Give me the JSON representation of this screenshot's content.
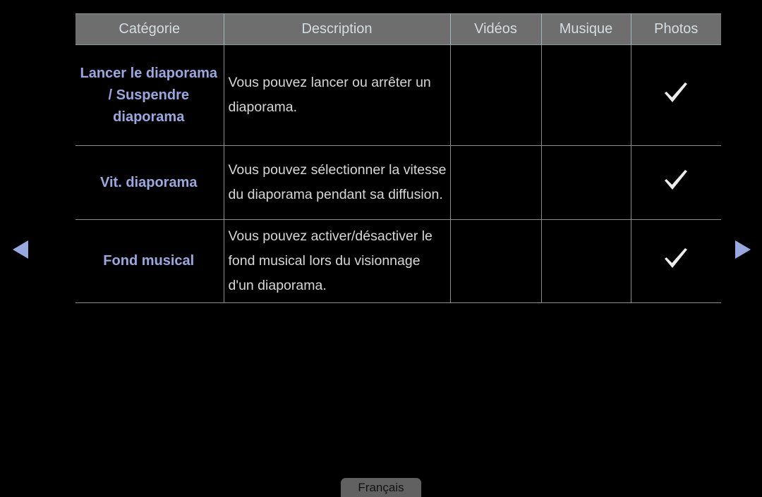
{
  "screen": {
    "background_color": "#000000",
    "accent_color": "#9aa8e0",
    "header_bg_color": "#6e6e6e",
    "description_text_color": "#d7d7d7"
  },
  "table": {
    "columns": [
      {
        "key": "categorie",
        "label": "Catégorie"
      },
      {
        "key": "description",
        "label": "Description"
      },
      {
        "key": "videos",
        "label": "Vidéos"
      },
      {
        "key": "musique",
        "label": "Musique"
      },
      {
        "key": "photos",
        "label": "Photos"
      }
    ],
    "rows": [
      {
        "categorie": "Lancer le diaporama / Suspendre diaporama",
        "description": "Vous pouvez lancer ou arrêter un diaporama.",
        "videos": "",
        "musique": "",
        "photos": "check"
      },
      {
        "categorie": "Vit. diaporama",
        "description": "Vous pouvez sélectionner la vitesse du diaporama pendant sa diffusion.",
        "videos": "",
        "musique": "",
        "photos": "check"
      },
      {
        "categorie": "Fond musical",
        "description": "Vous pouvez activer/désactiver le fond musical lors du visionnage d'un diaporama.",
        "videos": "",
        "musique": "",
        "photos": "check"
      }
    ]
  },
  "navigation": {
    "previous_icon": "triangle-left-icon",
    "next_icon": "triangle-right-icon"
  },
  "footer": {
    "language_label": "Français"
  }
}
